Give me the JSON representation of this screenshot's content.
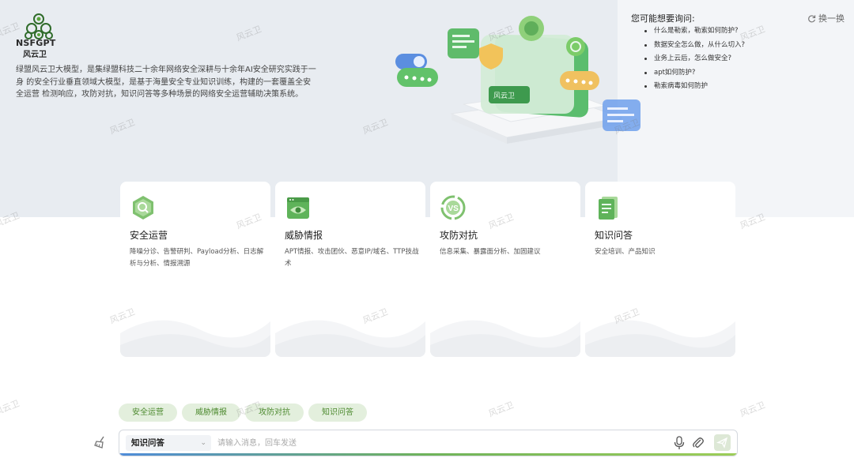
{
  "brand": {
    "logo_text": "NSFGPT",
    "logo_sub": "风云卫",
    "intro": "绿盟风云卫大模型，是集绿盟科技二十余年网络安全深耕与十余年AI安全研究实践于一身 的安全行业垂直领域大模型，是基于海量安全专业知识训练，构建的一套覆盖全安全运营 检测响应，攻防对抗，知识问答等多种场景的网络安全运营辅助决策系统。"
  },
  "suggestions": {
    "title": "您可能想要询问:",
    "refresh_label": "换一换",
    "items": [
      "什么是勒索，勒索如何防护?",
      "数据安全怎么做，从什么切入?",
      "业务上云后，怎么做安全?",
      "apt如何防护?",
      "勒索病毒如何防护"
    ]
  },
  "cards": [
    {
      "title": "安全运营",
      "desc": "降噪分诊、告警研判、Payload分析、日志解析与分析、情报溯源",
      "icon": "search-hexagon-icon"
    },
    {
      "title": "威胁情报",
      "desc": "APT情报、攻击团伙、恶意IP/域名、TTP技战术",
      "icon": "eye-window-icon"
    },
    {
      "title": "攻防对抗",
      "desc": "信息采集、暴露面分析、加固建议",
      "icon": "vs-icon"
    },
    {
      "title": "知识问答",
      "desc": "安全培训、产品知识",
      "icon": "document-icon"
    }
  ],
  "chips": [
    "安全运营",
    "威胁情报",
    "攻防对抗",
    "知识问答"
  ],
  "input": {
    "mode": "知识问答",
    "placeholder": "请输入消息，回车发送"
  },
  "watermark": "风云卫",
  "colors": {
    "accent": "#4d8a2f",
    "chip_bg": "#e3efdd",
    "top_band": "#e8ecf1"
  }
}
